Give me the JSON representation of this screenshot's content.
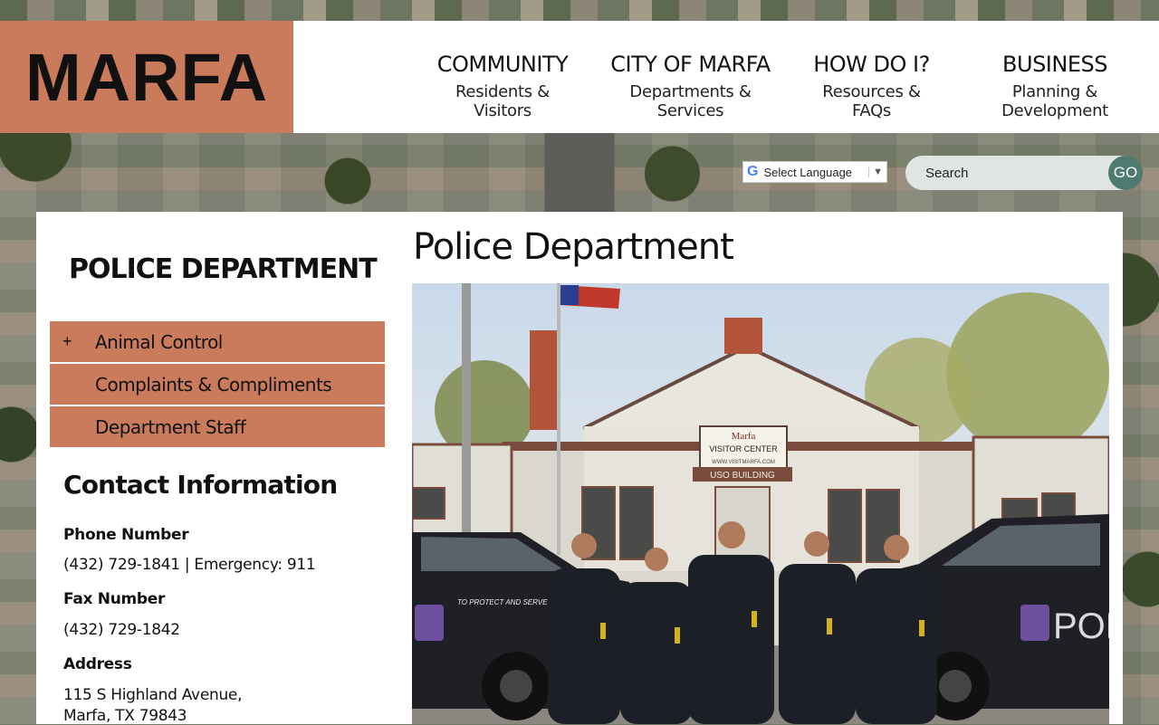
{
  "site": {
    "logo": "MARFA"
  },
  "nav": [
    {
      "title": "COMMUNITY",
      "subtitle": "Residents & Visitors"
    },
    {
      "title": "CITY OF MARFA",
      "subtitle": "Departments & Services"
    },
    {
      "title": "HOW DO I?",
      "subtitle": "Resources & FAQs"
    },
    {
      "title": "BUSINESS",
      "subtitle": "Planning & Development"
    }
  ],
  "translate": {
    "g": "G",
    "label": "Select Language",
    "arrow": "▼"
  },
  "search": {
    "placeholder": "Search",
    "go": "GO"
  },
  "sidebar": {
    "title": "POLICE DEPARTMENT",
    "items": [
      {
        "label": "Animal Control",
        "expand": "+"
      },
      {
        "label": "Complaints & Compliments"
      },
      {
        "label": "Department Staff"
      }
    ]
  },
  "contact": {
    "heading": "Contact Information",
    "phone_label": "Phone Number",
    "phone": "(432) 729-1841 | Emergency: 911",
    "fax_label": "Fax Number",
    "fax": "(432) 729-1842",
    "address_label": "Address",
    "address_line1": "115 S Highland Avenue,",
    "address_line2": "Marfa, TX 79843"
  },
  "main": {
    "title": "Police Department",
    "photo": {
      "sign_line1": "Marfa",
      "sign_line2": "VISITOR CENTER",
      "sign_line3": "WWW.VISITMARFA.COM",
      "building_label": "USO  BUILDING",
      "car_text": "TO PROTECT AND SERVE",
      "car_right_text": "POL"
    }
  },
  "colors": {
    "accent": "#c97b5c",
    "go_button": "#4f7a70",
    "search_bg": "#dfe5e1"
  }
}
